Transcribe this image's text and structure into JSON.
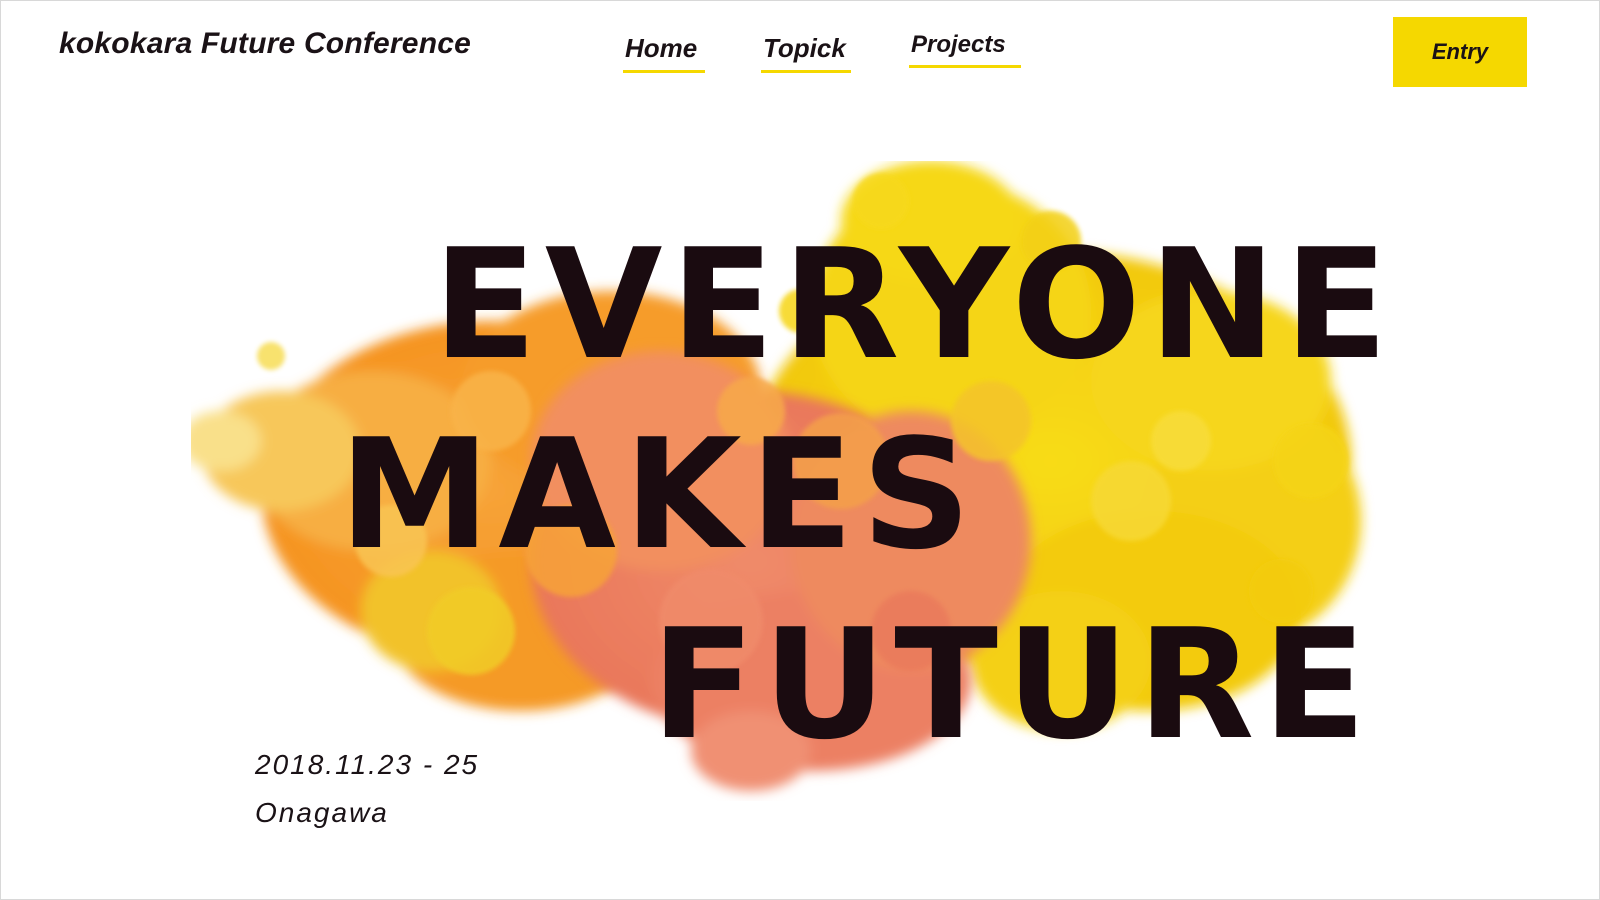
{
  "header": {
    "brand": "kokokara Future Conference",
    "nav": [
      {
        "label": "Home"
      },
      {
        "label": "Topick"
      },
      {
        "label": "Projects"
      }
    ],
    "entry_label": "Entry"
  },
  "hero": {
    "headline_lines": [
      "EVERYONE",
      "MAKES",
      "FUTURE"
    ],
    "date": "2018.11.23 - 25",
    "place": "Onagawa"
  },
  "colors": {
    "accent": "#f5d800",
    "text": "#1a0b10",
    "ink_yellow": "#f4d20f",
    "ink_orange": "#f59a2a",
    "ink_coral": "#ee8566"
  }
}
